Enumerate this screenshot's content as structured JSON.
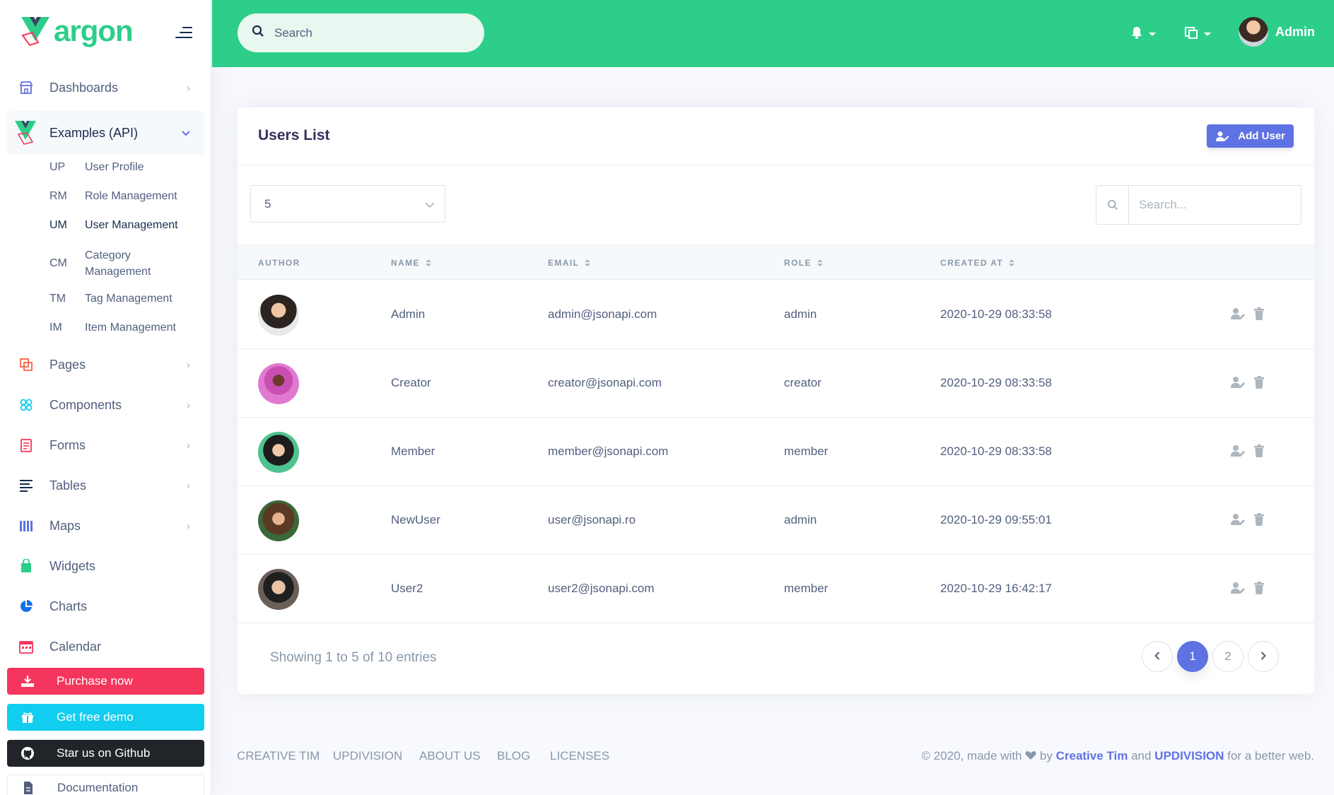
{
  "brand": {
    "logo_text": "argon"
  },
  "sidebar": {
    "items": [
      {
        "label": "Dashboards",
        "icon": "shop-icon",
        "color": "#5e72e4"
      },
      {
        "label": "Examples (API)",
        "icon": "vue-laravel-icon"
      },
      {
        "label": "Pages",
        "icon": "copy-icon",
        "color": "#fb6340"
      },
      {
        "label": "Components",
        "icon": "components-icon",
        "color": "#11cdef"
      },
      {
        "label": "Forms",
        "icon": "forms-icon",
        "color": "#f5365c"
      },
      {
        "label": "Tables",
        "icon": "tables-icon",
        "color": "#172b4d"
      },
      {
        "label": "Maps",
        "icon": "maps-icon",
        "color": "#5e72e4"
      },
      {
        "label": "Widgets",
        "icon": "widgets-icon",
        "color": "#2dce89"
      },
      {
        "label": "Charts",
        "icon": "charts-icon",
        "color": "#1171ef"
      },
      {
        "label": "Calendar",
        "icon": "calendar-icon",
        "color": "#f5365c"
      }
    ],
    "sub_items": [
      {
        "abbr": "UP",
        "label": "User Profile"
      },
      {
        "abbr": "RM",
        "label": "Role Management"
      },
      {
        "abbr": "UM",
        "label": "User Management"
      },
      {
        "abbr": "CM",
        "label": "Category Management"
      },
      {
        "abbr": "TM",
        "label": "Tag Management"
      },
      {
        "abbr": "IM",
        "label": "Item Management"
      }
    ],
    "cta": {
      "purchase": "Purchase now",
      "demo": "Get free demo",
      "github": "Star us on Github",
      "docs": "Documentation"
    }
  },
  "topbar": {
    "search_placeholder": "Search",
    "user_name": "Admin"
  },
  "card": {
    "title": "Users List",
    "add_button": "Add User",
    "per_page": "5",
    "search_placeholder": "Search...",
    "columns": [
      "AUTHOR",
      "NAME",
      "EMAIL",
      "ROLE",
      "CREATED AT"
    ],
    "rows": [
      {
        "name": "Admin",
        "email": "admin@jsonapi.com",
        "role": "admin",
        "created_at": "2020-10-29 08:33:58"
      },
      {
        "name": "Creator",
        "email": "creator@jsonapi.com",
        "role": "creator",
        "created_at": "2020-10-29 08:33:58"
      },
      {
        "name": "Member",
        "email": "member@jsonapi.com",
        "role": "member",
        "created_at": "2020-10-29 08:33:58"
      },
      {
        "name": "NewUser",
        "email": "user@jsonapi.ro",
        "role": "admin",
        "created_at": "2020-10-29 09:55:01"
      },
      {
        "name": "User2",
        "email": "user2@jsonapi.com",
        "role": "member",
        "created_at": "2020-10-29 16:42:17"
      }
    ],
    "showing": "Showing 1 to 5 of 10 entries",
    "pages": [
      "1",
      "2"
    ]
  },
  "footer": {
    "links": [
      "CREATIVE TIM",
      "UPDIVISION",
      "ABOUT US",
      "BLOG",
      "LICENSES"
    ],
    "copy_prefix": "© 2020, made with",
    "copy_by": "by",
    "creative_tim": "Creative Tim",
    "and": "and",
    "updivision": "UPDIVISION",
    "copy_suffix": "for a better web."
  },
  "colors": {
    "primary": "#5e72e4",
    "success": "#2dce89",
    "danger": "#f5365c",
    "info": "#11cdef",
    "dark": "#212529"
  }
}
